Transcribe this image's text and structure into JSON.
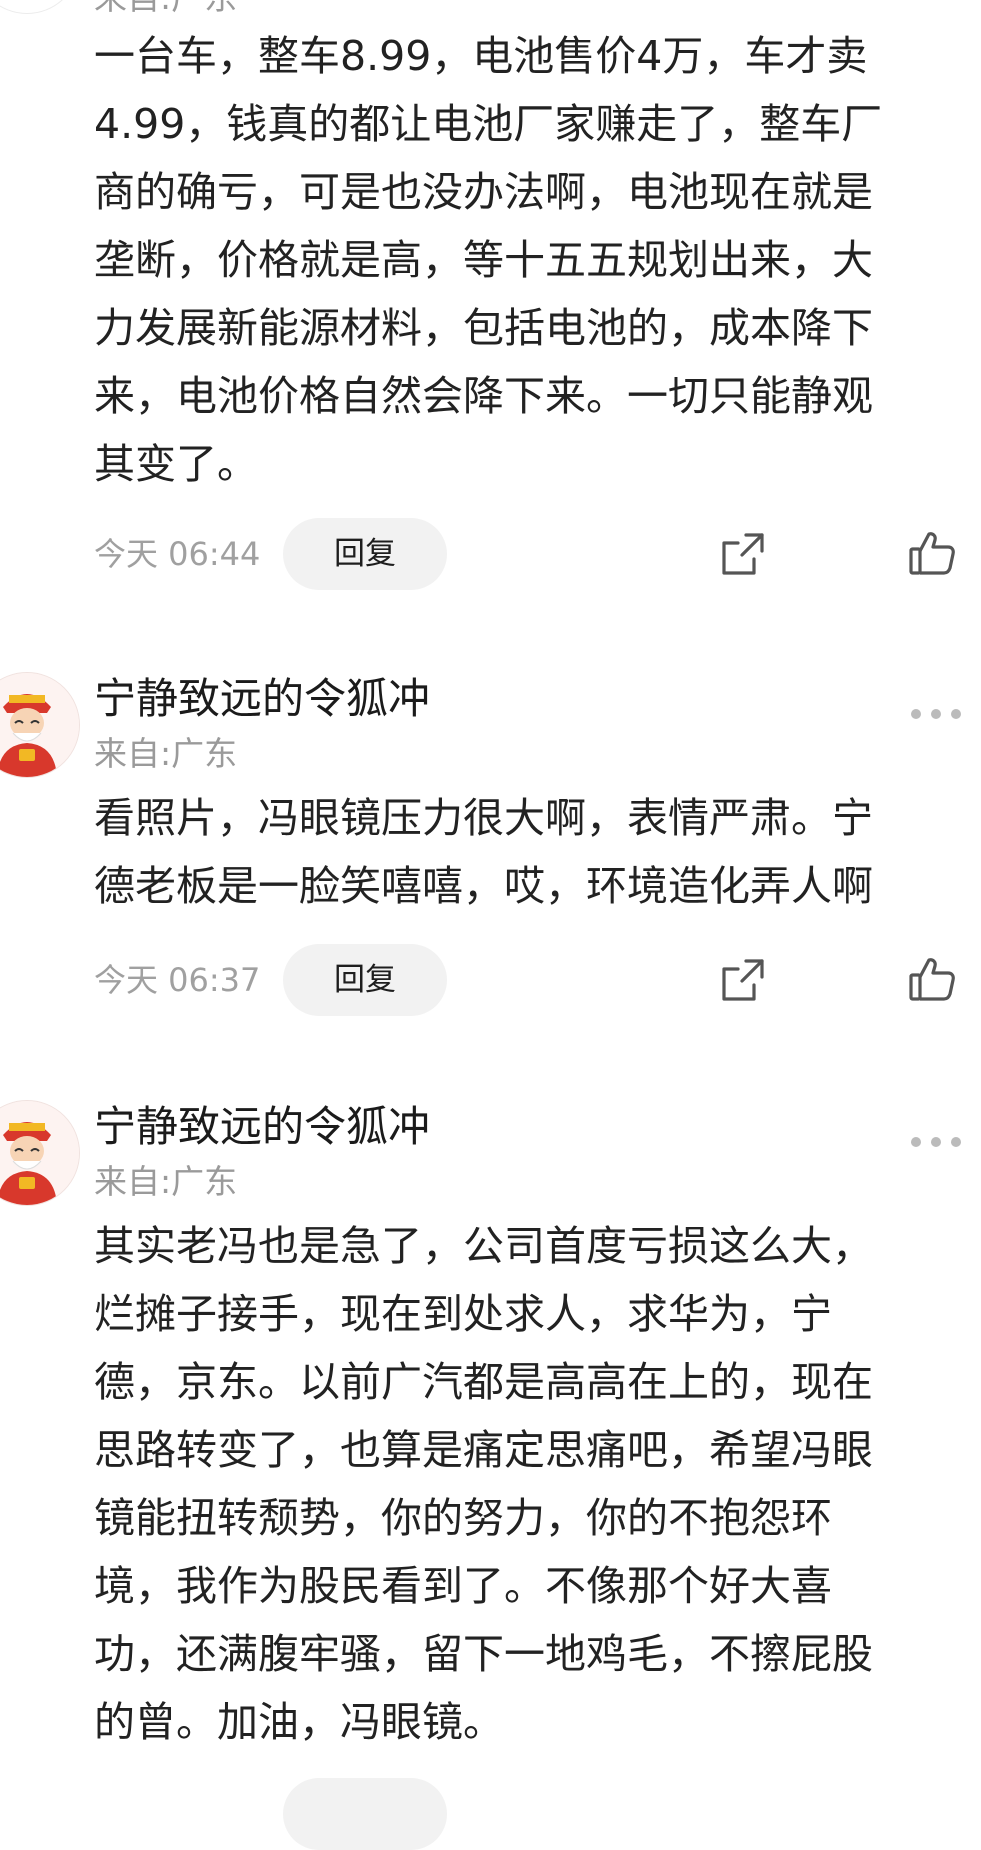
{
  "top_cutoff": {
    "location": "来自:广东"
  },
  "comments": [
    {
      "username": "",
      "location": "",
      "text_lines": [
        "一台车，整车8.99，电池售价4万，车才卖",
        "4.99，钱真的都让电池厂家赚走了，整车厂",
        "商的确亏，可是也没办法啊，电池现在就是",
        "垄断，价格就是高，等十五五规划出来，大",
        "力发展新能源材料，包括电池的，成本降下",
        "来，电池价格自然会降下来。一切只能静观",
        "其变了。"
      ],
      "time": "今天 06:44",
      "reply_label": "回复"
    },
    {
      "username": "宁静致远的令狐冲",
      "location": "来自:广东",
      "text_lines": [
        "看照片，冯眼镜压力很大啊，表情严肃。宁",
        "德老板是一脸笑嘻嘻，哎，环境造化弄人啊"
      ],
      "time": "今天 06:37",
      "reply_label": "回复"
    },
    {
      "username": "宁静致远的令狐冲",
      "location": "来自:广东",
      "text_lines": [
        "其实老冯也是急了，公司首度亏损这么大，",
        "烂摊子接手，现在到处求人，求华为，宁",
        "德，京东。以前广汽都是高高在上的，现在",
        "思路转变了，也算是痛定思痛吧，希望冯眼",
        "镜能扭转颓势，你的努力，你的不抱怨环",
        "境，我作为股民看到了。不像那个好大喜",
        "功，还满腹牢骚，留下一地鸡毛，不擦屁股",
        "的曾。加油，冯眼镜。"
      ],
      "time": "",
      "reply_label": ""
    }
  ],
  "icons": {
    "more": "more-horizontal-icon",
    "share": "share-icon",
    "like": "thumbs-up-icon",
    "avatar": "fortune-god-avatar"
  },
  "colors": {
    "text": "#222222",
    "secondary": "#9a9a9a",
    "reply_bg": "#f2f2f2",
    "avatar_red": "#d8382c",
    "avatar_gold": "#f2b824"
  }
}
